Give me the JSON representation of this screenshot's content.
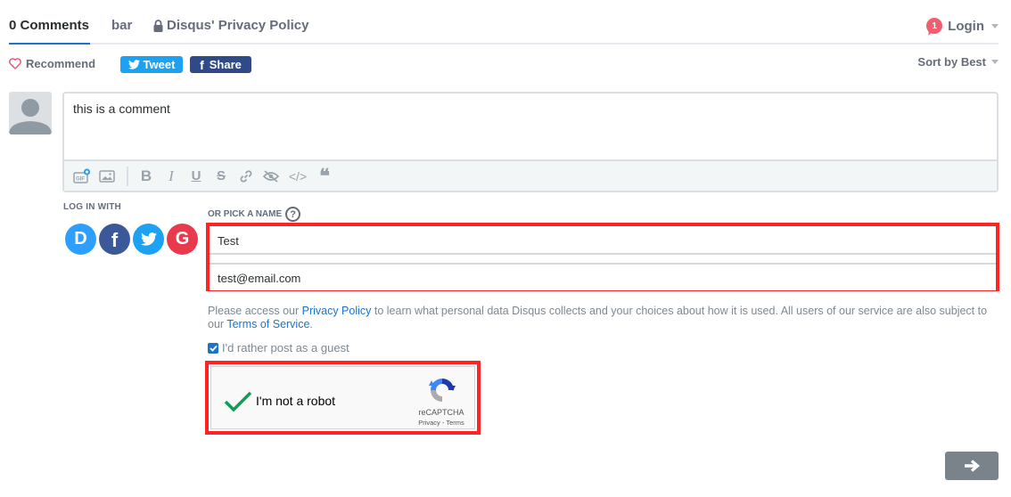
{
  "nav": {
    "tabs": [
      {
        "label": "0 Comments",
        "active": true
      },
      {
        "label": "bar",
        "active": false
      },
      {
        "label": "Disqus' Privacy Policy",
        "active": false,
        "icon": "lock-icon"
      }
    ],
    "login": {
      "label": "Login",
      "notification_count": "1"
    }
  },
  "actions": {
    "recommend_label": "Recommend",
    "tweet_label": "Tweet",
    "share_label": "Share",
    "sort_label": "Sort by Best"
  },
  "editor": {
    "text": "this is a comment",
    "toolbar": [
      {
        "name": "gif-icon",
        "glyph": "GIF"
      },
      {
        "name": "image-icon",
        "glyph": ""
      },
      {
        "name": "bold-icon",
        "glyph": "B"
      },
      {
        "name": "italic-icon",
        "glyph": "I"
      },
      {
        "name": "underline-icon",
        "glyph": "U"
      },
      {
        "name": "strikethrough-icon",
        "glyph": "S"
      },
      {
        "name": "link-icon",
        "glyph": ""
      },
      {
        "name": "spoiler-icon",
        "glyph": ""
      },
      {
        "name": "code-icon",
        "glyph": "</>"
      },
      {
        "name": "quote-icon",
        "glyph": "❝"
      }
    ]
  },
  "login_with": {
    "label": "LOG IN WITH",
    "providers": [
      "Disqus",
      "Facebook",
      "Twitter",
      "Google"
    ]
  },
  "guest": {
    "pick_label": "OR PICK A NAME",
    "help_glyph": "?",
    "name_value": "Test",
    "email_value": "test@email.com",
    "policy_prefix": "Please access our ",
    "policy_link": "Privacy Policy",
    "policy_middle": " to learn what personal data Disqus collects and your choices about how it is used. All users of our service are also subject to our ",
    "terms_link": "Terms of Service",
    "policy_suffix": ".",
    "guest_checkbox_label": "I'd rather post as a guest",
    "guest_checked": true
  },
  "captcha": {
    "label": "I'm not a robot",
    "brand": "reCAPTCHA",
    "links": "Privacy - Terms",
    "checked": true
  },
  "colors": {
    "accent": "#1d73c9",
    "highlight_outline": "#ff2323",
    "twitter": "#1da1f2",
    "facebook": "#2e4a88",
    "notification": "#f05f70"
  }
}
